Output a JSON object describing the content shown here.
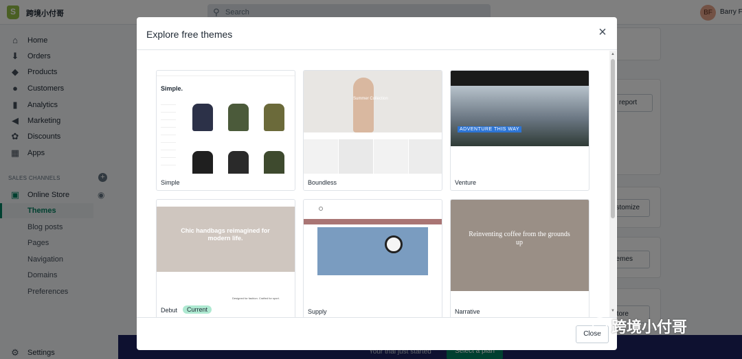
{
  "topbar": {
    "store_name": "跨境小付哥",
    "search_placeholder": "Search",
    "avatar_initials": "BF",
    "user_name": "Barry F"
  },
  "sidebar": {
    "items": [
      {
        "label": "Home",
        "icon": "home-icon",
        "glyph": "⌂"
      },
      {
        "label": "Orders",
        "icon": "orders-icon",
        "glyph": "⬇"
      },
      {
        "label": "Products",
        "icon": "tag-icon",
        "glyph": "◆"
      },
      {
        "label": "Customers",
        "icon": "person-icon",
        "glyph": "●"
      },
      {
        "label": "Analytics",
        "icon": "bar-chart-icon",
        "glyph": "▮"
      },
      {
        "label": "Marketing",
        "icon": "megaphone-icon",
        "glyph": "◀"
      },
      {
        "label": "Discounts",
        "icon": "discount-icon",
        "glyph": "✿"
      },
      {
        "label": "Apps",
        "icon": "apps-icon",
        "glyph": "▦"
      }
    ],
    "channels_heading": "SALES CHANNELS",
    "online_store": "Online Store",
    "sub_items": [
      "Themes",
      "Blog posts",
      "Pages",
      "Navigation",
      "Domains",
      "Preferences"
    ],
    "settings": "Settings"
  },
  "background": {
    "view_report": "w report",
    "customize": "ustomize",
    "themes": "hemes",
    "store": "Store",
    "trial_text": "Your trial just started",
    "select_plan": "Select a plan"
  },
  "modal": {
    "title": "Explore free themes",
    "close_label": "Close",
    "themes": [
      {
        "name": "Simple",
        "current": false
      },
      {
        "name": "Boundless",
        "current": false
      },
      {
        "name": "Venture",
        "current": false
      },
      {
        "name": "Debut",
        "current": true,
        "badge": "Current"
      },
      {
        "name": "Supply",
        "current": false
      },
      {
        "name": "Narrative",
        "current": false
      }
    ],
    "previews": {
      "simple_title": "Simple.",
      "boundless_text": "Summer Collection",
      "venture_text": "ADVENTURE THIS WAY",
      "debut_text": "Chic handbags reimagined for modern life.",
      "debut_small": "Designed for fashion. Crafted for sport.",
      "narrative_text": "Reinventing coffee from the grounds up"
    }
  },
  "watermark": "跨境小付哥",
  "colors": {
    "accent": "#008060",
    "logo": "#95bf47",
    "bottom_bar": "#1c2260",
    "current_badge": "#aee9d1"
  }
}
